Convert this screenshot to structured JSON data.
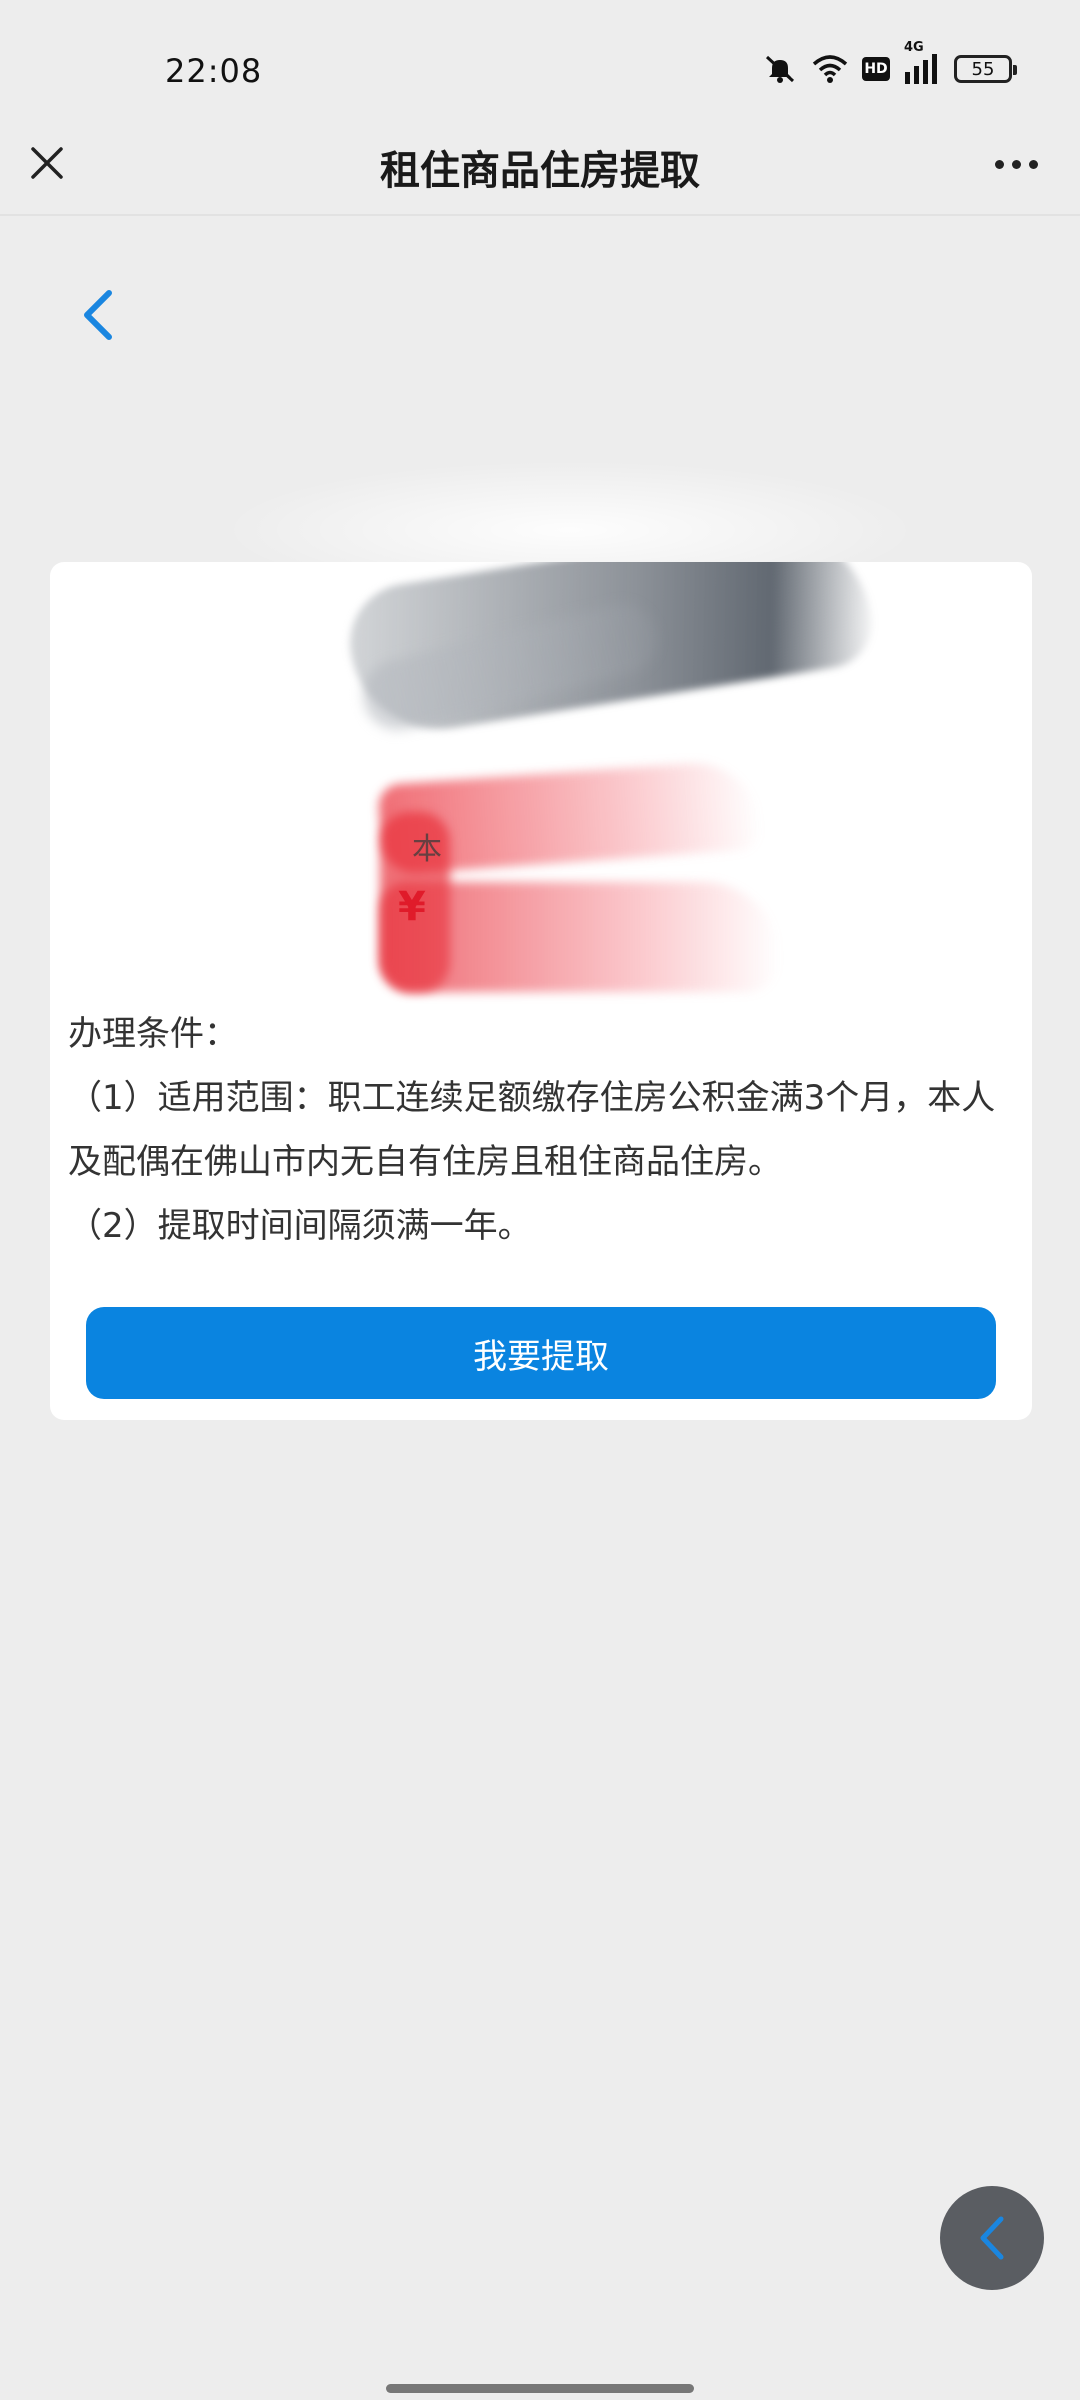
{
  "status_bar": {
    "time": "22:08",
    "network": "4G",
    "hd_label": "HD",
    "battery": "55"
  },
  "header": {
    "title": "租住商品住房提取"
  },
  "hero": {
    "text_top": "本",
    "currency_text": "¥"
  },
  "conditions": {
    "heading": "办理条件：",
    "items": [
      "（1）适用范围：职工连续足额缴存住房公积金满3个月，本人及配偶在佛山市内无自有住房且租住商品住房。",
      "（2）提取时间间隔须满一年。"
    ]
  },
  "actions": {
    "primary_label": "我要提取"
  },
  "icons": {
    "close": "close-icon",
    "more": "more-dots-icon",
    "back": "chevron-left-icon",
    "float_back": "chevron-left-icon"
  },
  "colors": {
    "accent": "#0a84e0",
    "background": "#ededed",
    "card": "#ffffff",
    "float_button": "#5a5d62"
  }
}
